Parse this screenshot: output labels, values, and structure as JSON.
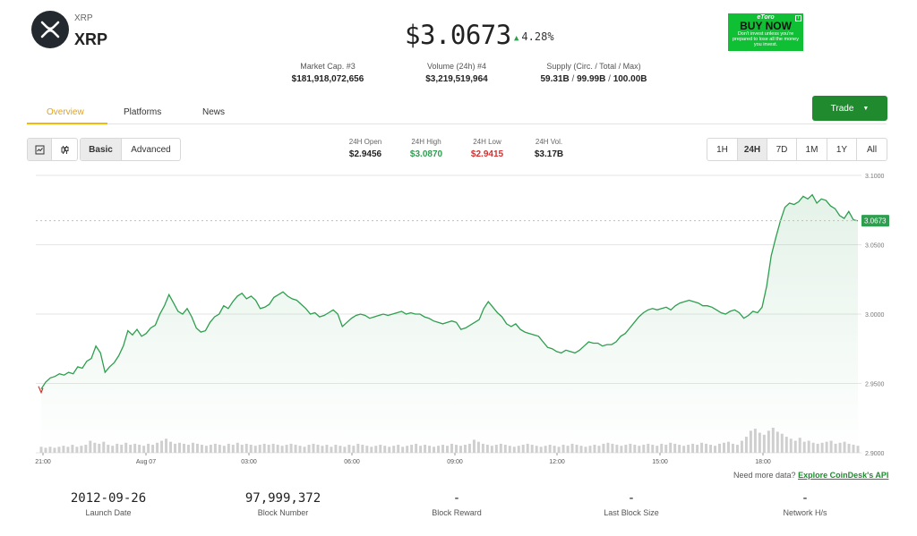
{
  "coin": {
    "symbol": "XRP",
    "name": "XRP",
    "logo_icon": "xrp-logo-icon"
  },
  "price": {
    "value": "$3.0673",
    "change": "4.28%",
    "direction_icon": "up-triangle-icon"
  },
  "ad": {
    "brand": "eToro",
    "cta": "BUY NOW",
    "note": "Don't invest unless you're prepared to lose all the money you invest.",
    "bg_color": "#0fbf34"
  },
  "stats": {
    "market_cap": {
      "label": "Market Cap. #3",
      "value": "$181,918,072,656"
    },
    "volume": {
      "label": "Volume (24h) #4",
      "value": "$3,219,519,964"
    },
    "supply": {
      "label": "Supply (Circ. / Total / Max)",
      "circ": "59.31B",
      "total": "99.99B",
      "max": "100.00B",
      "separator": "/"
    }
  },
  "tabs": [
    {
      "label": "Overview",
      "active": true
    },
    {
      "label": "Platforms"
    },
    {
      "label": "News"
    }
  ],
  "trade_button": {
    "label": "Trade",
    "icon": "caret-down-icon",
    "color": "#1f8a2e"
  },
  "chart_style": {
    "icons": [
      "line-chart-icon",
      "candlestick-icon"
    ]
  },
  "mode": {
    "basic": "Basic",
    "advanced": "Advanced",
    "selected": "Basic"
  },
  "ohlc": {
    "open": {
      "label": "24H Open",
      "value": "$2.9456"
    },
    "high": {
      "label": "24H High",
      "value": "$3.0870",
      "color": "#2e9e4f"
    },
    "low": {
      "label": "24H Low",
      "value": "$2.9415",
      "color": "#d62f2f"
    },
    "vol": {
      "label": "24H Vol.",
      "value": "$3.17B"
    }
  },
  "ranges": {
    "options": [
      "1H",
      "24H",
      "7D",
      "1M",
      "1Y",
      "All"
    ],
    "selected": "24H"
  },
  "chart_data": {
    "type": "area",
    "x_ticks": [
      "21:00",
      "Aug 07",
      "03:00",
      "06:00",
      "09:00",
      "12:00",
      "15:00",
      "18:00"
    ],
    "y_ticks": [
      "3.1000",
      "3.0500",
      "3.0000",
      "2.9500",
      "2.9000"
    ],
    "ylim": [
      2.9,
      3.1
    ],
    "current_label": "3.0673",
    "line_color": "#2e9e4f",
    "series": [
      {
        "values": [
          2.946,
          2.951,
          2.954,
          2.955,
          2.957,
          2.956,
          2.958,
          2.957,
          2.962,
          2.961,
          2.966,
          2.968,
          2.977,
          2.972,
          2.958,
          2.962,
          2.965,
          2.97,
          2.977,
          2.988,
          2.985,
          2.989,
          2.984,
          2.986,
          2.99,
          2.992,
          3.0,
          3.006,
          3.014,
          3.008,
          3.002,
          3.0,
          3.004,
          2.998,
          2.99,
          2.987,
          2.988,
          2.994,
          2.998,
          3.0,
          3.006,
          3.004,
          3.009,
          3.013,
          3.015,
          3.011,
          3.013,
          3.01,
          3.004,
          3.005,
          3.007,
          3.012,
          3.014,
          3.016,
          3.013,
          3.011,
          3.01,
          3.007,
          3.004,
          3.0,
          3.001,
          2.998,
          2.999,
          3.001,
          3.003,
          3.0,
          2.991,
          2.994,
          2.997,
          2.999,
          3.0,
          2.999,
          2.997,
          2.998,
          2.999,
          3.0,
          2.999,
          3.0,
          3.001,
          3.002,
          3.0,
          3.001,
          3.0,
          3.0,
          2.998,
          2.997,
          2.995,
          2.994,
          2.993,
          2.994,
          2.995,
          2.994,
          2.989,
          2.99,
          2.992,
          2.994,
          2.996,
          3.004,
          3.009,
          3.005,
          3.001,
          2.998,
          2.993,
          2.991,
          2.993,
          2.989,
          2.987,
          2.986,
          2.985,
          2.984,
          2.98,
          2.976,
          2.975,
          2.973,
          2.972,
          2.974,
          2.973,
          2.972,
          2.974,
          2.977,
          2.98,
          2.979,
          2.979,
          2.977,
          2.978,
          2.978,
          2.98,
          2.984,
          2.986,
          2.99,
          2.994,
          2.998,
          3.001,
          3.003,
          3.004,
          3.003,
          3.004,
          3.005,
          3.003,
          3.006,
          3.008,
          3.009,
          3.01,
          3.009,
          3.008,
          3.006,
          3.006,
          3.005,
          3.003,
          3.001,
          3.0,
          3.002,
          3.003,
          3.001,
          2.997,
          2.999,
          3.002,
          3.001,
          3.005,
          3.02,
          3.042,
          3.055,
          3.067,
          3.077,
          3.08,
          3.079,
          3.081,
          3.085,
          3.083,
          3.086,
          3.08,
          3.083,
          3.082,
          3.078,
          3.076,
          3.071,
          3.069,
          3.074,
          3.068,
          3.0673
        ]
      }
    ],
    "volume_values": [
      6,
      5,
      6,
      5,
      6,
      7,
      6,
      8,
      6,
      7,
      8,
      12,
      10,
      9,
      11,
      8,
      7,
      9,
      8,
      10,
      8,
      9,
      8,
      7,
      9,
      8,
      10,
      12,
      14,
      11,
      9,
      10,
      9,
      8,
      10,
      9,
      8,
      7,
      8,
      9,
      8,
      7,
      9,
      8,
      10,
      8,
      9,
      8,
      7,
      8,
      9,
      8,
      9,
      8,
      7,
      8,
      9,
      8,
      7,
      6,
      8,
      9,
      8,
      7,
      8,
      6,
      8,
      7,
      6,
      8,
      7,
      9,
      8,
      7,
      6,
      7,
      8,
      7,
      6,
      7,
      8,
      6,
      7,
      8,
      9,
      7,
      8,
      7,
      6,
      7,
      8,
      7,
      9,
      8,
      7,
      8,
      9,
      13,
      11,
      9,
      8,
      7,
      8,
      9,
      8,
      7,
      6,
      7,
      8,
      9,
      8,
      7,
      6,
      7,
      8,
      7,
      6,
      8,
      7,
      9,
      8,
      7,
      6,
      7,
      8,
      7,
      9,
      10,
      9,
      8,
      7,
      8,
      9,
      8,
      7,
      8,
      9,
      8,
      7,
      9,
      8,
      10,
      9,
      8,
      7,
      8,
      9,
      8,
      10,
      9,
      8,
      7,
      9,
      10,
      11,
      9,
      8,
      12,
      16,
      22,
      24,
      20,
      18,
      22,
      25,
      21,
      19,
      16,
      14,
      12,
      15,
      11,
      12,
      10,
      9,
      10,
      11,
      12,
      9,
      10,
      11,
      9,
      8,
      7
    ]
  },
  "more_data": {
    "text": "Need more data?",
    "link": "Explore CoinDesk's API"
  },
  "block_stats": [
    {
      "value": "2012-09-26",
      "label": "Launch Date"
    },
    {
      "value": "97,999,372",
      "label": "Block Number"
    },
    {
      "value": "-",
      "label": "Block Reward"
    },
    {
      "value": "-",
      "label": "Last Block Size"
    },
    {
      "value": "-",
      "label": "Network H/s"
    }
  ]
}
